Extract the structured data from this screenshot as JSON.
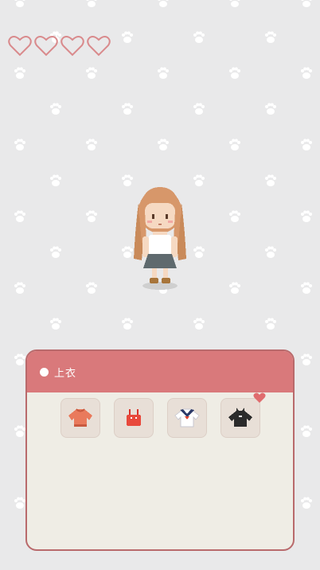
{
  "hud": {
    "hearts_total": 4,
    "hearts_filled": 0,
    "colors": {
      "heart_outline": "#d98a8c"
    }
  },
  "background": {
    "pattern_icon": "paw-print-icon",
    "color": "#e9e9ea",
    "paw_color": "#ffffff"
  },
  "character": {
    "name_icon": "pixel-girl-avatar"
  },
  "wardrobe": {
    "category_label": "上衣",
    "colors": {
      "header": "#d9797b",
      "border": "#b96a6c",
      "body": "#efede5"
    },
    "items": [
      {
        "icon": "orange-sweater-icon",
        "favorite": false
      },
      {
        "icon": "red-camisole-icon",
        "favorite": false
      },
      {
        "icon": "sailor-top-icon",
        "favorite": false
      },
      {
        "icon": "black-cat-shirt-icon",
        "favorite": true
      }
    ]
  }
}
